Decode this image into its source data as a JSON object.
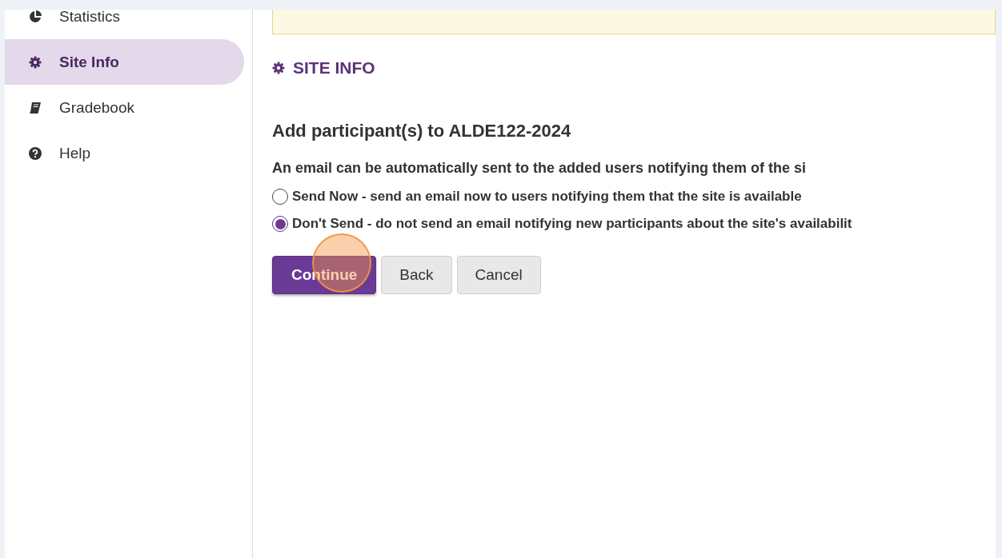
{
  "sidebar": {
    "items": [
      {
        "label": "Statistics",
        "kind": "chart",
        "selected": false
      },
      {
        "label": "Site Info",
        "kind": "gear",
        "selected": true
      },
      {
        "label": "Gradebook",
        "kind": "book",
        "selected": false
      },
      {
        "label": "Help",
        "kind": "help",
        "selected": false
      }
    ]
  },
  "main": {
    "heading": "SITE INFO",
    "title": "Add participant(s) to ALDE122-2024",
    "intro": "An email can be automatically sent to the added users notifying them of the si",
    "options": [
      {
        "label": "Send Now - send an email now to users notifying them that the site is available",
        "selected": false
      },
      {
        "label": "Don't Send - do not send an email notifying new participants about the site's availabilit",
        "selected": true
      }
    ],
    "buttons": [
      {
        "label": "Continue",
        "kind": "primary"
      },
      {
        "label": "Back",
        "kind": "default"
      },
      {
        "label": "Cancel",
        "kind": "default"
      }
    ]
  }
}
